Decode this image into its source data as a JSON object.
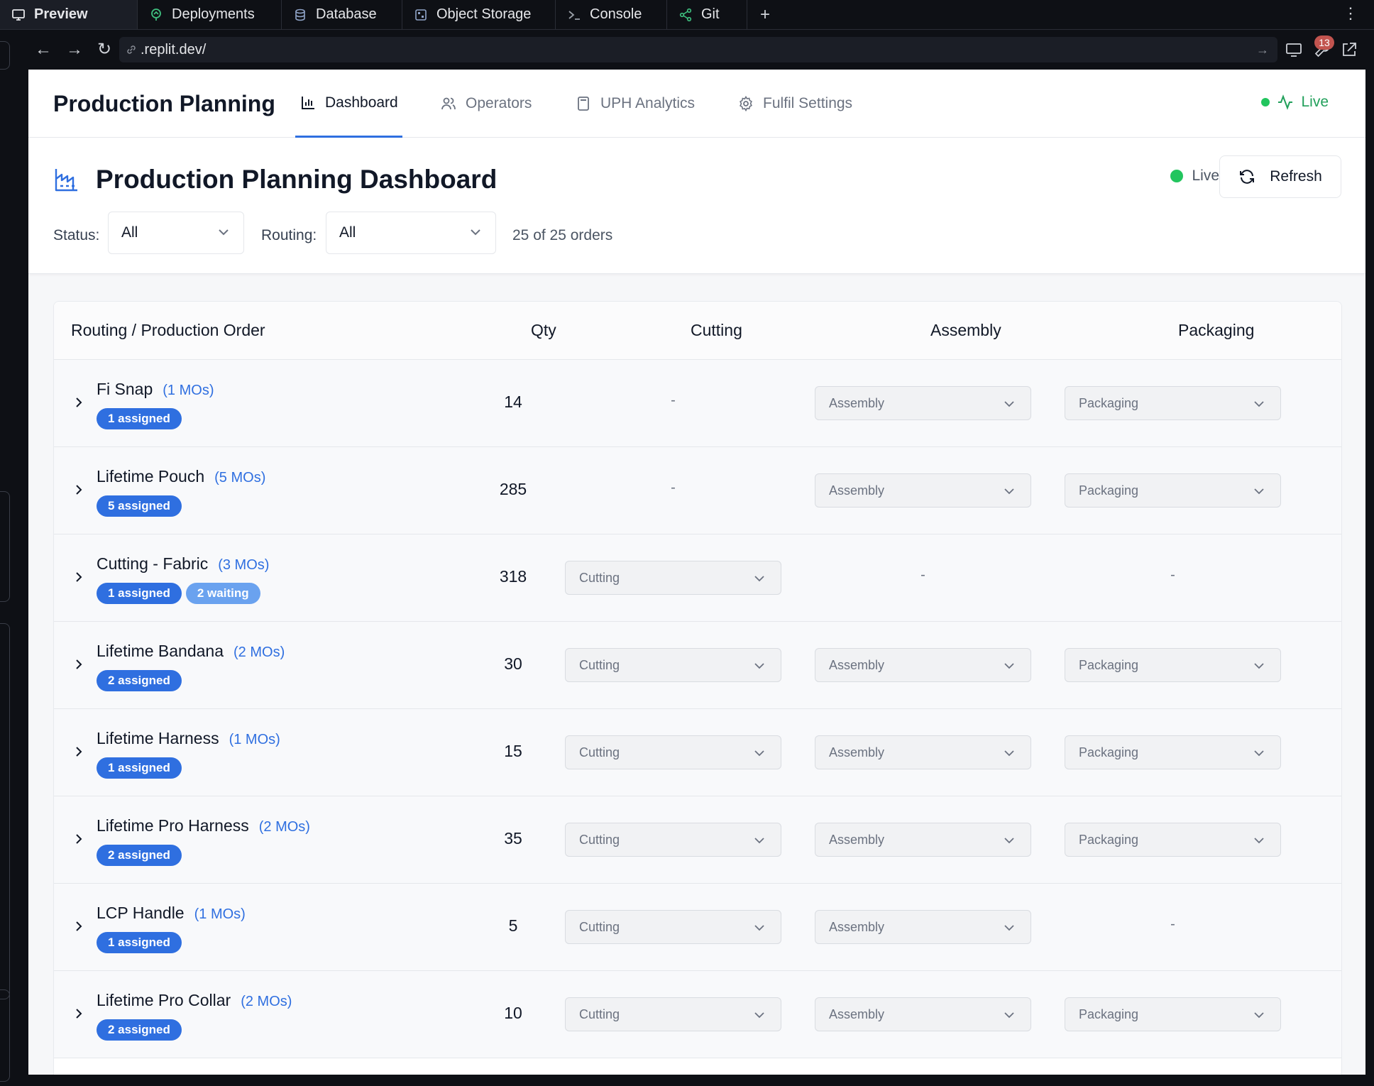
{
  "ide": {
    "tabs": [
      {
        "label": "Preview",
        "icon": "monitor-icon"
      },
      {
        "label": "Deployments",
        "icon": "deploy-icon"
      },
      {
        "label": "Database",
        "icon": "database-icon"
      },
      {
        "label": "Object Storage",
        "icon": "storage-icon"
      },
      {
        "label": "Console",
        "icon": "terminal-icon"
      },
      {
        "label": "Git",
        "icon": "git-icon"
      }
    ],
    "new_tab": "+",
    "menu": "⋮",
    "url": ".replit.dev/",
    "devtools_badge": "13"
  },
  "nav": {
    "brand": "Production Planning",
    "tabs": [
      {
        "label": "Dashboard",
        "icon": "bar-chart-icon"
      },
      {
        "label": "Operators",
        "icon": "users-icon"
      },
      {
        "label": "UPH Analytics",
        "icon": "calculator-icon"
      },
      {
        "label": "Fulfil Settings",
        "icon": "gear-icon"
      }
    ],
    "live": "Live"
  },
  "header": {
    "title": "Production Planning Dashboard",
    "live": "Live",
    "refresh": "Refresh",
    "status_label": "Status:",
    "status_value": "All",
    "routing_label": "Routing:",
    "routing_value": "All",
    "count": "25 of 25 orders"
  },
  "colors": {
    "accent": "#2f6fe0",
    "live": "#22c55e",
    "pill_waiting": "#6aa2ef"
  },
  "table": {
    "headers": [
      "Routing / Production Order",
      "Qty",
      "Cutting",
      "Assembly",
      "Packaging"
    ],
    "rows": [
      {
        "name": "Fi Snap",
        "mos": "(1 MOs)",
        "badges": [
          {
            "text": "1 assigned",
            "type": "assigned"
          }
        ],
        "qty": "14",
        "cutting": "-",
        "assembly": "Assembly",
        "packaging": "Packaging"
      },
      {
        "name": "Lifetime Pouch",
        "mos": "(5 MOs)",
        "badges": [
          {
            "text": "5 assigned",
            "type": "assigned"
          }
        ],
        "qty": "285",
        "cutting": "-",
        "assembly": "Assembly",
        "packaging": "Packaging"
      },
      {
        "name": "Cutting - Fabric",
        "mos": "(3 MOs)",
        "badges": [
          {
            "text": "1 assigned",
            "type": "assigned"
          },
          {
            "text": "2 waiting",
            "type": "waiting"
          }
        ],
        "qty": "318",
        "cutting": "Cutting",
        "assembly": "-",
        "packaging": "-"
      },
      {
        "name": "Lifetime Bandana",
        "mos": "(2 MOs)",
        "badges": [
          {
            "text": "2 assigned",
            "type": "assigned"
          }
        ],
        "qty": "30",
        "cutting": "Cutting",
        "assembly": "Assembly",
        "packaging": "Packaging"
      },
      {
        "name": "Lifetime Harness",
        "mos": "(1 MOs)",
        "badges": [
          {
            "text": "1 assigned",
            "type": "assigned"
          }
        ],
        "qty": "15",
        "cutting": "Cutting",
        "assembly": "Assembly",
        "packaging": "Packaging"
      },
      {
        "name": "Lifetime Pro Harness",
        "mos": "(2 MOs)",
        "badges": [
          {
            "text": "2 assigned",
            "type": "assigned"
          }
        ],
        "qty": "35",
        "cutting": "Cutting",
        "assembly": "Assembly",
        "packaging": "Packaging"
      },
      {
        "name": "LCP Handle",
        "mos": "(1 MOs)",
        "badges": [
          {
            "text": "1 assigned",
            "type": "assigned"
          }
        ],
        "qty": "5",
        "cutting": "Cutting",
        "assembly": "Assembly",
        "packaging": "-"
      },
      {
        "name": "Lifetime Pro Collar",
        "mos": "(2 MOs)",
        "badges": [
          {
            "text": "2 assigned",
            "type": "assigned"
          }
        ],
        "qty": "10",
        "cutting": "Cutting",
        "assembly": "Assembly",
        "packaging": "Packaging"
      }
    ]
  }
}
